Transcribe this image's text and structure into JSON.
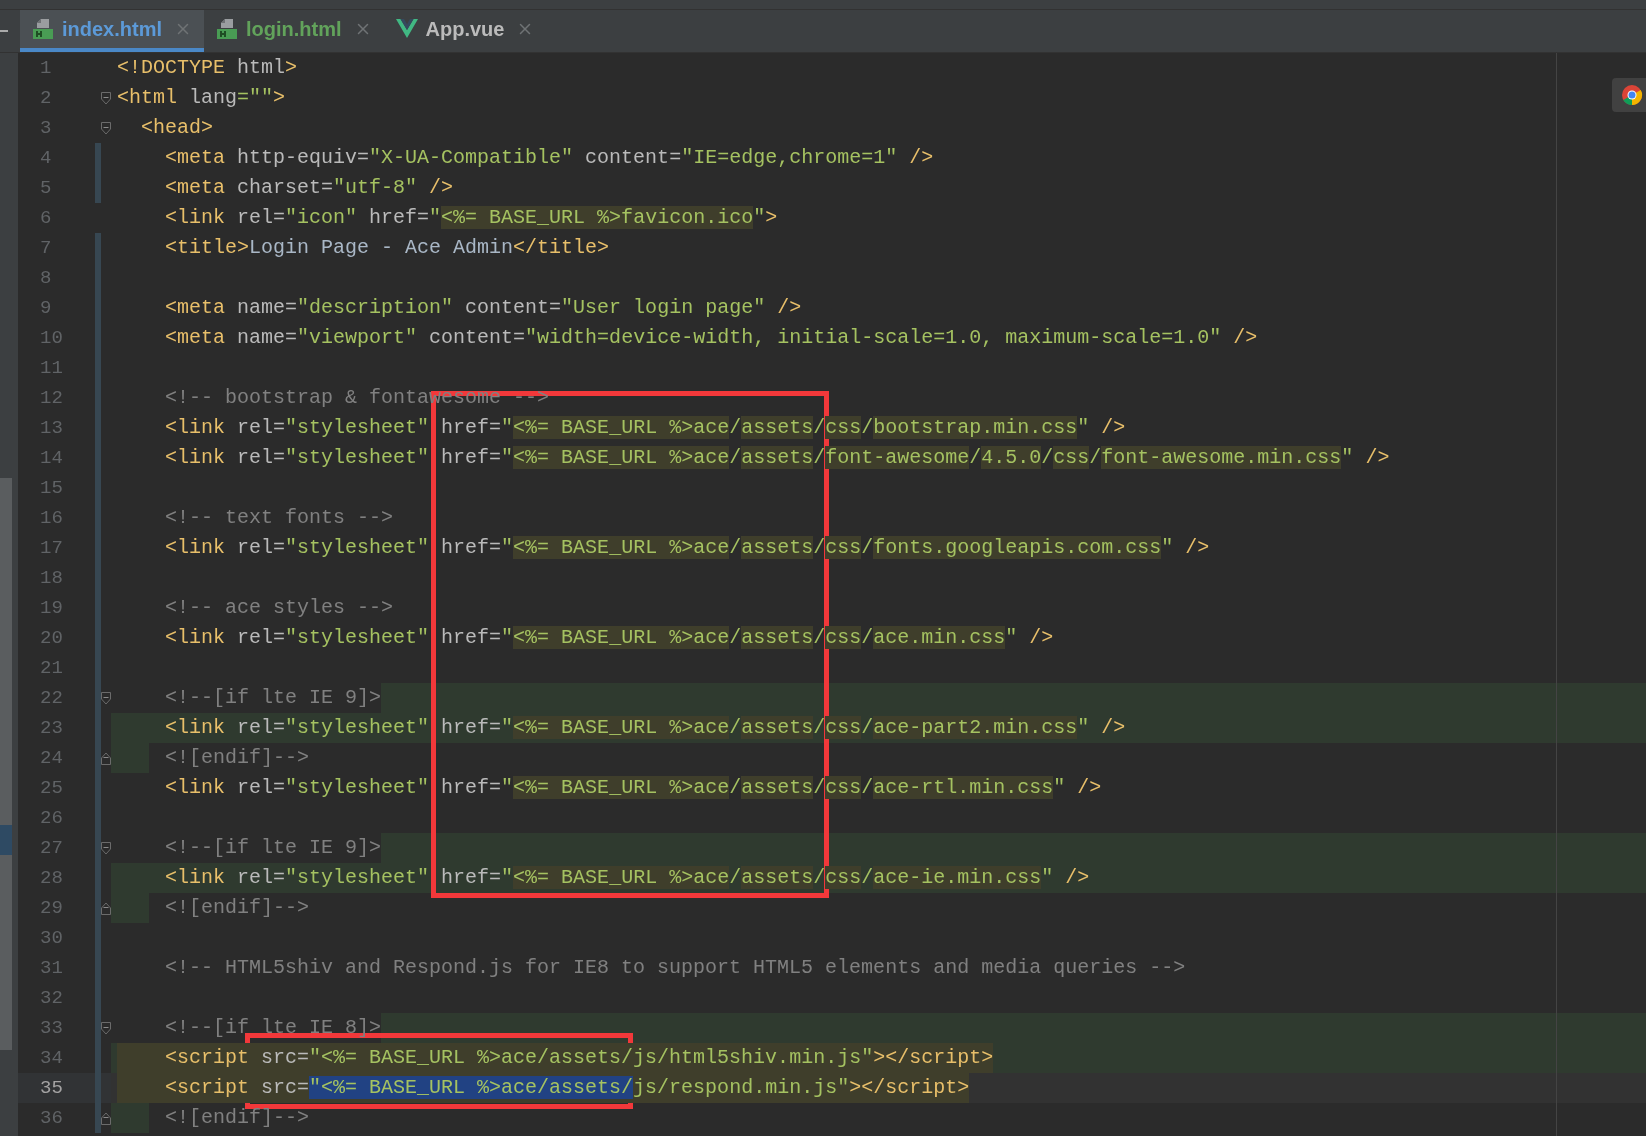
{
  "tabs": [
    {
      "label": "index.html",
      "selected": true,
      "color": "#5c9ad8",
      "kind": "html"
    },
    {
      "label": "login.html",
      "selected": false,
      "color": "#62a35b",
      "kind": "html"
    },
    {
      "label": "App.vue",
      "selected": false,
      "color": "#bbbbbb",
      "kind": "vue"
    }
  ],
  "editor": {
    "lines": [
      {
        "number": "1",
        "kind": "plain",
        "changed": false,
        "current": false,
        "tokens": [
          {
            "kind": "tag",
            "text": "<!DOCTYPE"
          },
          {
            "kind": "attr",
            "text": " html"
          },
          {
            "kind": "tag",
            "text": ">"
          }
        ]
      },
      {
        "number": "2",
        "kind": "fold-open",
        "changed": false,
        "current": false,
        "tokens": [
          {
            "kind": "tag",
            "text": "<html"
          },
          {
            "kind": "attr",
            "text": " lang"
          },
          {
            "kind": "str",
            "text": "=\"\""
          },
          {
            "kind": "tag",
            "text": ">"
          }
        ]
      },
      {
        "number": "3",
        "kind": "fold-open",
        "changed": false,
        "current": false,
        "tokens": [
          {
            "kind": "tag",
            "text": "  <head>"
          }
        ]
      },
      {
        "number": "4",
        "kind": "plain",
        "changed": true,
        "current": false,
        "tokens": [
          {
            "kind": "tag",
            "text": "    <meta"
          },
          {
            "kind": "attr",
            "text": " http-equiv="
          },
          {
            "kind": "str",
            "text": "\"X-UA-Compatible\""
          },
          {
            "kind": "attr",
            "text": " content="
          },
          {
            "kind": "str",
            "text": "\"IE=edge,chrome=1\""
          },
          {
            "kind": "tag",
            "text": " />"
          }
        ]
      },
      {
        "number": "5",
        "kind": "plain",
        "changed": true,
        "current": false,
        "tokens": [
          {
            "kind": "tag",
            "text": "    <meta"
          },
          {
            "kind": "attr",
            "text": " charset="
          },
          {
            "kind": "str",
            "text": "\"utf-8\""
          },
          {
            "kind": "tag",
            "text": " />"
          }
        ]
      },
      {
        "number": "6",
        "kind": "plain",
        "changed": false,
        "current": false,
        "tokens": [
          {
            "kind": "tag",
            "text": "    <link"
          },
          {
            "kind": "attr",
            "text": " rel="
          },
          {
            "kind": "str",
            "text": "\"icon\""
          },
          {
            "kind": "attr",
            "text": " href="
          },
          {
            "kind": "str",
            "text": "\""
          },
          {
            "kind": "tpl",
            "text": "<%= BASE_URL %>favicon.ico"
          },
          {
            "kind": "str",
            "text": "\""
          },
          {
            "kind": "tag",
            "text": ">"
          }
        ]
      },
      {
        "number": "7",
        "kind": "plain",
        "changed": true,
        "current": false,
        "tokens": [
          {
            "kind": "tag",
            "text": "    <title>"
          },
          {
            "kind": "text",
            "text": "Login Page - Ace Admin"
          },
          {
            "kind": "tag",
            "text": "</title>"
          }
        ]
      },
      {
        "number": "8",
        "kind": "plain",
        "changed": true,
        "current": false
      },
      {
        "number": "9",
        "kind": "plain",
        "changed": true,
        "current": false,
        "tokens": [
          {
            "kind": "tag",
            "text": "    <meta"
          },
          {
            "kind": "attr",
            "text": " name="
          },
          {
            "kind": "str",
            "text": "\"description\""
          },
          {
            "kind": "attr",
            "text": " content="
          },
          {
            "kind": "str",
            "text": "\"User login page\""
          },
          {
            "kind": "tag",
            "text": " />"
          }
        ]
      },
      {
        "number": "10",
        "kind": "plain",
        "changed": true,
        "current": false,
        "tokens": [
          {
            "kind": "tag",
            "text": "    <meta"
          },
          {
            "kind": "attr",
            "text": " name="
          },
          {
            "kind": "str",
            "text": "\"viewport\""
          },
          {
            "kind": "attr",
            "text": " content="
          },
          {
            "kind": "str",
            "text": "\"width=device-width, initial-scale=1.0, maximum-scale=1.0\""
          },
          {
            "kind": "tag",
            "text": " />"
          }
        ]
      },
      {
        "number": "11",
        "kind": "plain",
        "changed": true,
        "current": false
      },
      {
        "number": "12",
        "kind": "plain",
        "changed": true,
        "current": false,
        "tokens": [
          {
            "kind": "cmt",
            "text": "    <!-- bootstrap & fontawesome -->"
          }
        ]
      },
      {
        "number": "13",
        "kind": "plain",
        "changed": true,
        "current": false,
        "tokens": [
          {
            "kind": "tag",
            "text": "    <link"
          },
          {
            "kind": "attr",
            "text": " rel="
          },
          {
            "kind": "str",
            "text": "\"stylesheet\""
          },
          {
            "kind": "attr",
            "text": " href="
          },
          {
            "kind": "str",
            "text": "\""
          },
          {
            "kind": "tpl",
            "text": "<%= BASE_URL %>ace"
          },
          {
            "kind": "str",
            "text": "/"
          },
          {
            "kind": "tpl",
            "text": "assets"
          },
          {
            "kind": "str",
            "text": "/"
          },
          {
            "kind": "tpl",
            "text": "css"
          },
          {
            "kind": "str",
            "text": "/"
          },
          {
            "kind": "tpl",
            "text": "bootstrap.min.css"
          },
          {
            "kind": "str",
            "text": "\""
          },
          {
            "kind": "tag",
            "text": " />"
          }
        ]
      },
      {
        "number": "14",
        "kind": "plain",
        "changed": true,
        "current": false,
        "tokens": [
          {
            "kind": "tag",
            "text": "    <link"
          },
          {
            "kind": "attr",
            "text": " rel="
          },
          {
            "kind": "str",
            "text": "\"stylesheet\""
          },
          {
            "kind": "attr",
            "text": " href="
          },
          {
            "kind": "str",
            "text": "\""
          },
          {
            "kind": "tpl",
            "text": "<%= BASE_URL %>ace"
          },
          {
            "kind": "str",
            "text": "/"
          },
          {
            "kind": "tpl",
            "text": "assets"
          },
          {
            "kind": "str",
            "text": "/"
          },
          {
            "kind": "tpl",
            "text": "font-awesome"
          },
          {
            "kind": "str",
            "text": "/"
          },
          {
            "kind": "tpl",
            "text": "4.5.0"
          },
          {
            "kind": "str",
            "text": "/"
          },
          {
            "kind": "tpl",
            "text": "css"
          },
          {
            "kind": "str",
            "text": "/"
          },
          {
            "kind": "tpl",
            "text": "font-awesome.min.css"
          },
          {
            "kind": "str",
            "text": "\""
          },
          {
            "kind": "tag",
            "text": " />"
          }
        ]
      },
      {
        "number": "15",
        "kind": "plain",
        "changed": true,
        "current": false
      },
      {
        "number": "16",
        "kind": "plain",
        "changed": true,
        "current": false,
        "tokens": [
          {
            "kind": "cmt",
            "text": "    <!-- text fonts -->"
          }
        ]
      },
      {
        "number": "17",
        "kind": "plain",
        "changed": true,
        "current": false,
        "tokens": [
          {
            "kind": "tag",
            "text": "    <link"
          },
          {
            "kind": "attr",
            "text": " rel="
          },
          {
            "kind": "str",
            "text": "\"stylesheet\""
          },
          {
            "kind": "attr",
            "text": " href="
          },
          {
            "kind": "str",
            "text": "\""
          },
          {
            "kind": "tpl",
            "text": "<%= BASE_URL %>ace"
          },
          {
            "kind": "str",
            "text": "/"
          },
          {
            "kind": "tpl",
            "text": "assets"
          },
          {
            "kind": "str",
            "text": "/"
          },
          {
            "kind": "tpl",
            "text": "css"
          },
          {
            "kind": "str",
            "text": "/"
          },
          {
            "kind": "tpl",
            "text": "fonts.googleapis.com.css"
          },
          {
            "kind": "str",
            "text": "\""
          },
          {
            "kind": "tag",
            "text": " />"
          }
        ]
      },
      {
        "number": "18",
        "kind": "plain",
        "changed": true,
        "current": false
      },
      {
        "number": "19",
        "kind": "plain",
        "changed": true,
        "current": false,
        "tokens": [
          {
            "kind": "cmt",
            "text": "    <!-- ace styles -->"
          }
        ]
      },
      {
        "number": "20",
        "kind": "plain",
        "changed": true,
        "current": false,
        "tokens": [
          {
            "kind": "tag",
            "text": "    <link"
          },
          {
            "kind": "attr",
            "text": " rel="
          },
          {
            "kind": "str",
            "text": "\"stylesheet\""
          },
          {
            "kind": "attr",
            "text": " href="
          },
          {
            "kind": "str",
            "text": "\""
          },
          {
            "kind": "tpl",
            "text": "<%= BASE_URL %>ace"
          },
          {
            "kind": "str",
            "text": "/"
          },
          {
            "kind": "tpl",
            "text": "assets"
          },
          {
            "kind": "str",
            "text": "/"
          },
          {
            "kind": "tpl",
            "text": "css"
          },
          {
            "kind": "str",
            "text": "/"
          },
          {
            "kind": "tpl",
            "text": "ace.min.css"
          },
          {
            "kind": "str",
            "text": "\""
          },
          {
            "kind": "tag",
            "text": " />"
          }
        ]
      },
      {
        "number": "21",
        "kind": "plain",
        "changed": true,
        "current": false
      },
      {
        "number": "22",
        "kind": "cond-open",
        "changed": true,
        "current": false,
        "tokens": [
          {
            "kind": "cmt",
            "text": "    <!--[if lte IE 9]>"
          }
        ]
      },
      {
        "number": "23",
        "kind": "cond-body",
        "changed": true,
        "current": false,
        "tokens": [
          {
            "kind": "tag",
            "text": "    <link"
          },
          {
            "kind": "attr",
            "text": " rel="
          },
          {
            "kind": "str",
            "text": "\"stylesheet\""
          },
          {
            "kind": "attr",
            "text": " href="
          },
          {
            "kind": "str",
            "text": "\""
          },
          {
            "kind": "tpl",
            "text": "<%= BASE_URL %>ace"
          },
          {
            "kind": "str",
            "text": "/"
          },
          {
            "kind": "tpl",
            "text": "assets"
          },
          {
            "kind": "str",
            "text": "/"
          },
          {
            "kind": "tpl",
            "text": "css"
          },
          {
            "kind": "str",
            "text": "/"
          },
          {
            "kind": "tpl",
            "text": "ace-part2.min.css"
          },
          {
            "kind": "str",
            "text": "\""
          },
          {
            "kind": "tag",
            "text": " />"
          }
        ]
      },
      {
        "number": "24",
        "kind": "cond-close",
        "changed": true,
        "current": false,
        "tokens": [
          {
            "kind": "cmt",
            "text": "    <![endif]-->"
          }
        ]
      },
      {
        "number": "25",
        "kind": "plain",
        "changed": true,
        "current": false,
        "tokens": [
          {
            "kind": "tag",
            "text": "    <link"
          },
          {
            "kind": "attr",
            "text": " rel="
          },
          {
            "kind": "str",
            "text": "\"stylesheet\""
          },
          {
            "kind": "attr",
            "text": " href="
          },
          {
            "kind": "str",
            "text": "\""
          },
          {
            "kind": "tpl",
            "text": "<%= BASE_URL %>ace"
          },
          {
            "kind": "str",
            "text": "/"
          },
          {
            "kind": "tpl",
            "text": "assets"
          },
          {
            "kind": "str",
            "text": "/"
          },
          {
            "kind": "tpl",
            "text": "css"
          },
          {
            "kind": "str",
            "text": "/"
          },
          {
            "kind": "tpl",
            "text": "ace-rtl.min.css"
          },
          {
            "kind": "str",
            "text": "\""
          },
          {
            "kind": "tag",
            "text": " />"
          }
        ]
      },
      {
        "number": "26",
        "kind": "plain",
        "changed": true,
        "current": false
      },
      {
        "number": "27",
        "kind": "cond-open",
        "changed": true,
        "current": false,
        "tokens": [
          {
            "kind": "cmt",
            "text": "    <!--[if lte IE 9]>"
          }
        ]
      },
      {
        "number": "28",
        "kind": "cond-body",
        "changed": true,
        "current": false,
        "tokens": [
          {
            "kind": "tag",
            "text": "    <link"
          },
          {
            "kind": "attr",
            "text": " rel="
          },
          {
            "kind": "str",
            "text": "\"stylesheet\""
          },
          {
            "kind": "attr",
            "text": " href="
          },
          {
            "kind": "str",
            "text": "\""
          },
          {
            "kind": "tpl",
            "text": "<%= BASE_URL %>ace"
          },
          {
            "kind": "str",
            "text": "/"
          },
          {
            "kind": "tpl",
            "text": "assets"
          },
          {
            "kind": "str",
            "text": "/"
          },
          {
            "kind": "tpl",
            "text": "css"
          },
          {
            "kind": "str",
            "text": "/"
          },
          {
            "kind": "tpl",
            "text": "ace-ie.min.css"
          },
          {
            "kind": "str",
            "text": "\""
          },
          {
            "kind": "tag",
            "text": " />"
          }
        ]
      },
      {
        "number": "29",
        "kind": "cond-close",
        "changed": true,
        "current": false,
        "tokens": [
          {
            "kind": "cmt",
            "text": "    <![endif]-->"
          }
        ]
      },
      {
        "number": "30",
        "kind": "plain",
        "changed": true,
        "current": false
      },
      {
        "number": "31",
        "kind": "plain",
        "changed": true,
        "current": false,
        "tokens": [
          {
            "kind": "cmt",
            "text": "    <!-- HTML5shiv and Respond.js for IE8 to support HTML5 elements and media queries -->"
          }
        ]
      },
      {
        "number": "32",
        "kind": "plain",
        "changed": true,
        "current": false
      },
      {
        "number": "33",
        "kind": "cond-open",
        "changed": true,
        "current": false,
        "tokens": [
          {
            "kind": "cmt",
            "text": "    <!--[if lte IE 8]>"
          }
        ]
      },
      {
        "number": "34",
        "kind": "script",
        "changed": true,
        "current": false,
        "tokens": [
          {
            "kind": "tag",
            "text": "    <script"
          },
          {
            "kind": "attr",
            "text": " src="
          },
          {
            "kind": "str",
            "text": "\"<%= BASE_URL %>ace/assets/js/html5shiv.min.js\""
          },
          {
            "kind": "tag",
            "text": "></script>"
          }
        ]
      },
      {
        "number": "35",
        "kind": "script",
        "changed": true,
        "current": true,
        "tokens": [
          {
            "kind": "tag",
            "text": "    <script"
          },
          {
            "kind": "attr",
            "text": " src="
          },
          {
            "kind": "sel",
            "text": "\"<%= BASE_URL %>ace/assets/"
          },
          {
            "kind": "str",
            "text": "js/respond.min.js\""
          },
          {
            "kind": "tag",
            "text": "></script>"
          }
        ]
      },
      {
        "number": "36",
        "kind": "cond-close",
        "changed": true,
        "current": false,
        "tokens": [
          {
            "kind": "cmt",
            "text": "    <![endif]-->"
          }
        ]
      }
    ]
  },
  "annotations": [
    {
      "color": "#f2383a"
    },
    {
      "color": "#f2383a"
    }
  ]
}
